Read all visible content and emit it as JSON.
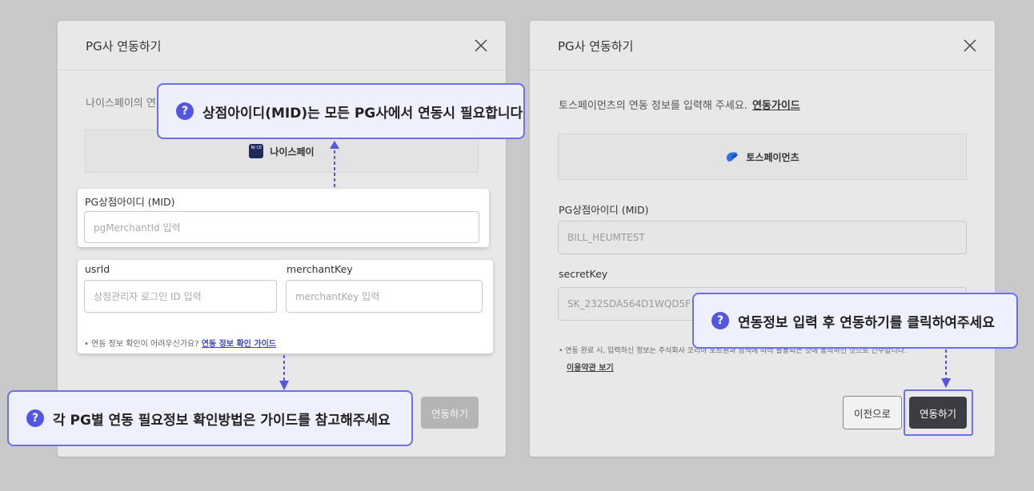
{
  "left_modal": {
    "title": "PG사 연동하기",
    "description_prefix": "나이스페이의 연",
    "pg_name": "나이스페이",
    "pg_logo_text": "NI CE",
    "mid_label": "PG상점아이디 (MID)",
    "mid_placeholder": "pgMerchantId 입력",
    "usrid_label": "usrId",
    "usrid_placeholder": "상점관리자 로그인 ID 입력",
    "merchantkey_label": "merchantKey",
    "merchantkey_placeholder": "merchantKey 입력",
    "note_text": "연동 정보 확인이 어려우신가요?",
    "note_link": "연동 정보 확인 가이드",
    "submit_label": "연동하기"
  },
  "right_modal": {
    "title": "PG사 연동하기",
    "description": "토스페이먼츠의 연동 정보를 입력해 주세요.",
    "guide_link": "연동가이드",
    "pg_name": "토스페이먼츠",
    "mid_label": "PG상점아이디 (MID)",
    "mid_value": "BILL_HEUMTEST",
    "secret_label": "secretKey",
    "secret_value": "SK_232SDA564D1WQD5F1",
    "note_text": "연동 완료 시, 입력하신 정보는 주식회사 코리아 포트원과 정책에 따라 활용되는 것에 동의하신 것으로 간주합니다.",
    "terms_link": "이용약관 보기",
    "back_label": "이전으로",
    "submit_label": "연동하기"
  },
  "callouts": {
    "mid": "상점아이디(MID)는 모든 PG사에서 연동시 필요합니다",
    "guide": "각 PG별 연동 필요정보 확인방법은 가이드를 참고해주세요",
    "submit": "연동정보 입력 후 연동하기를 클릭하여주세요",
    "icon_glyph": "?"
  },
  "colors": {
    "accent": "#6b6ff0",
    "callout_bg": "#eef1fd",
    "dark_button": "#3c3d42"
  }
}
